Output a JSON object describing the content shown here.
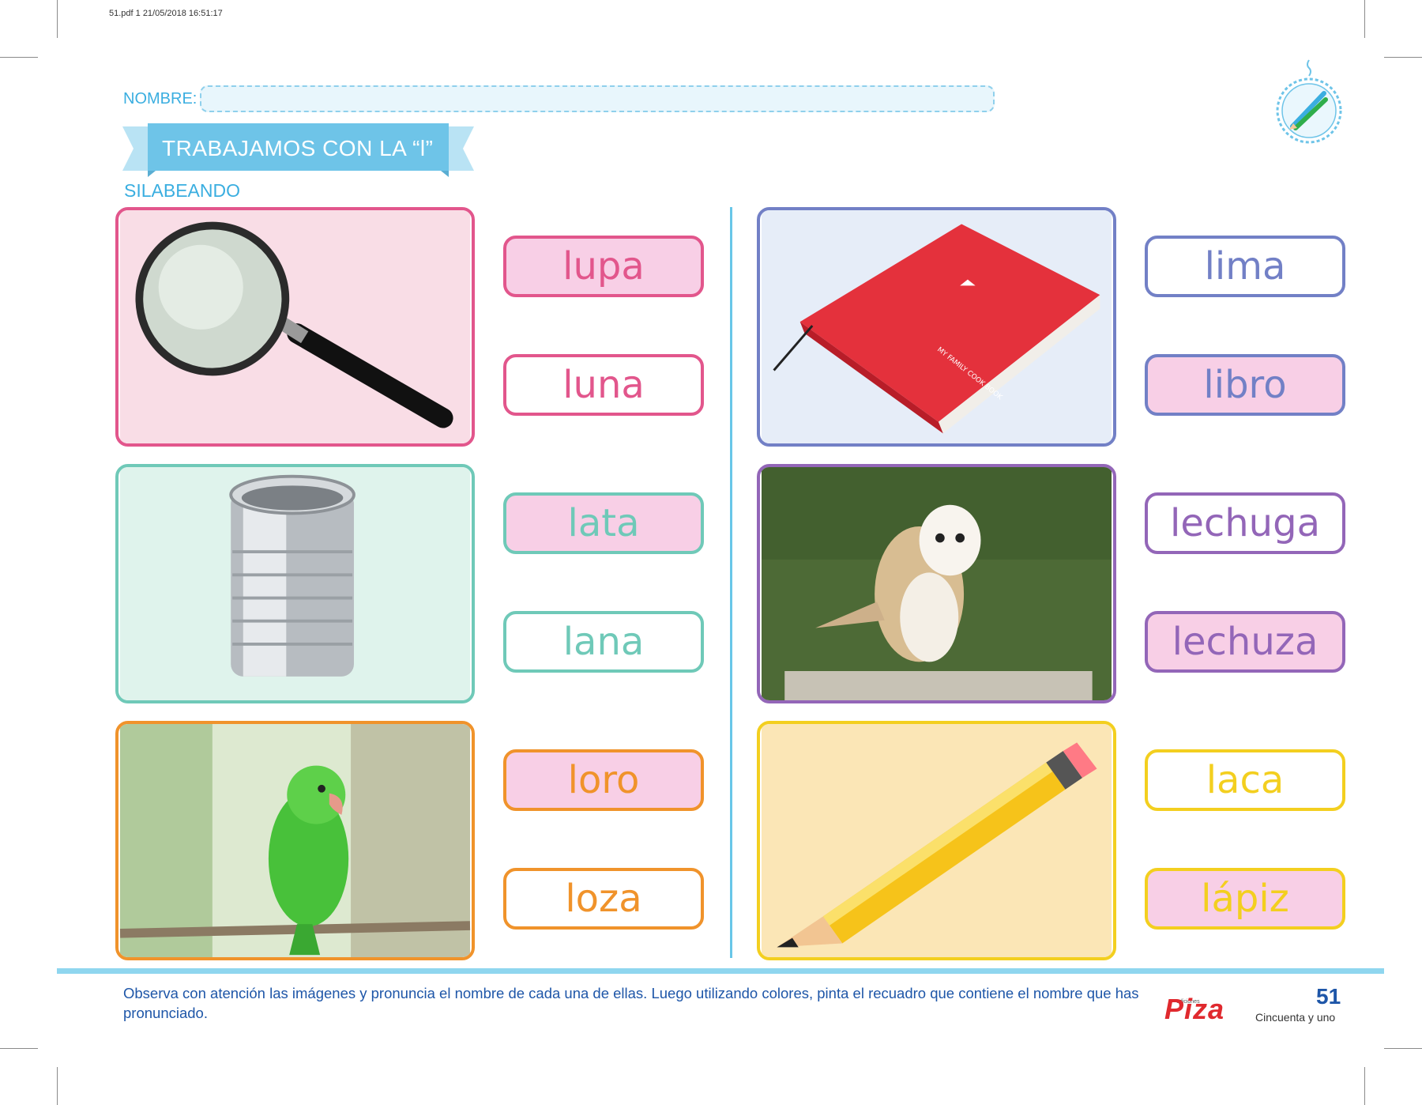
{
  "print_info": "51.pdf  1  21/05/2018  16:51:17",
  "header": {
    "name_label": "NOMBRE:",
    "ribbon_title": "TRABAJAMOS CON LA “l”",
    "subtitle": "SILABEANDO"
  },
  "left_column": [
    {
      "image": "magnifying-glass",
      "color": "#e2568c",
      "fill": "#f9dde6",
      "options": [
        {
          "text": "lupa",
          "filled": true
        },
        {
          "text": "luna",
          "filled": false
        }
      ]
    },
    {
      "image": "tin-can",
      "color": "#6fc9b8",
      "fill": "#dff3ec",
      "options": [
        {
          "text": "lata",
          "filled": true
        },
        {
          "text": "lana",
          "filled": false
        }
      ]
    },
    {
      "image": "parrot",
      "color": "#f0932b",
      "fill": "#dde9d0",
      "options": [
        {
          "text": "loro",
          "filled": true
        },
        {
          "text": "loza",
          "filled": false
        }
      ]
    }
  ],
  "right_column": [
    {
      "image": "red-book",
      "color": "#7280c6",
      "fill": "#e6edf8",
      "book_text": "MY FAMILY COOK BOOK",
      "options": [
        {
          "text": "lima",
          "filled": false
        },
        {
          "text": "libro",
          "filled": true
        }
      ]
    },
    {
      "image": "owl",
      "color": "#9366b8",
      "fill": "#4d6a36",
      "options": [
        {
          "text": "lechuga",
          "filled": false
        },
        {
          "text": "lechuza",
          "filled": true
        }
      ]
    },
    {
      "image": "pencil",
      "color": "#f3cf1f",
      "fill": "#fbe6b6",
      "options": [
        {
          "text": "laca",
          "filled": false
        },
        {
          "text": "lápiz",
          "filled": true
        }
      ]
    }
  ],
  "word_fill_color": "#f8cfe6",
  "footer": {
    "instructions": "Observa con atención las imágenes y pronuncia el nombre de cada una de ellas. Luego utilizando colores, pinta el recuadro que contiene el nombre que has pronunciado.",
    "logo_small": "ediciones",
    "logo": "Piza",
    "page_number": "51",
    "page_words": "Cincuenta y uno"
  }
}
